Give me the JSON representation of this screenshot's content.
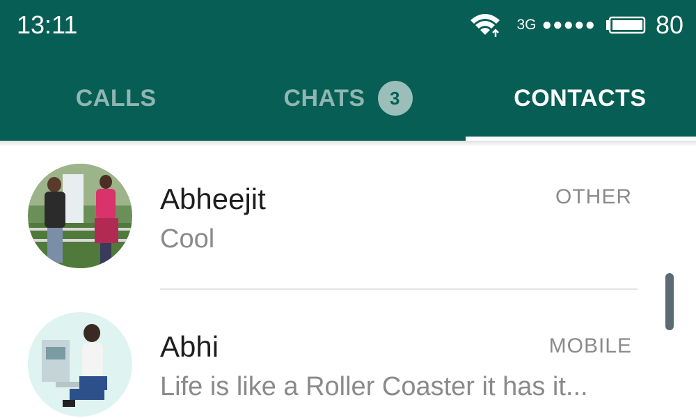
{
  "status_bar": {
    "time": "13:11",
    "network": "3G",
    "signal_dots": "●●●●●",
    "battery_percent": "80",
    "icons": [
      "wifi-icon",
      "signal-icon",
      "battery-icon"
    ]
  },
  "tabs": [
    {
      "label": "CALLS",
      "active": false
    },
    {
      "label": "CHATS",
      "badge": "3",
      "active": false
    },
    {
      "label": "CONTACTS",
      "active": true
    }
  ],
  "contacts": [
    {
      "name": "Abheejit",
      "status": "Cool",
      "type": "OTHER"
    },
    {
      "name": "Abhi",
      "status": "Life is like a Roller Coaster it has it...",
      "type": "MOBILE"
    }
  ],
  "colors": {
    "header": "#075e54",
    "text_primary": "#1d1d1d",
    "text_secondary": "#8a8a8a"
  }
}
